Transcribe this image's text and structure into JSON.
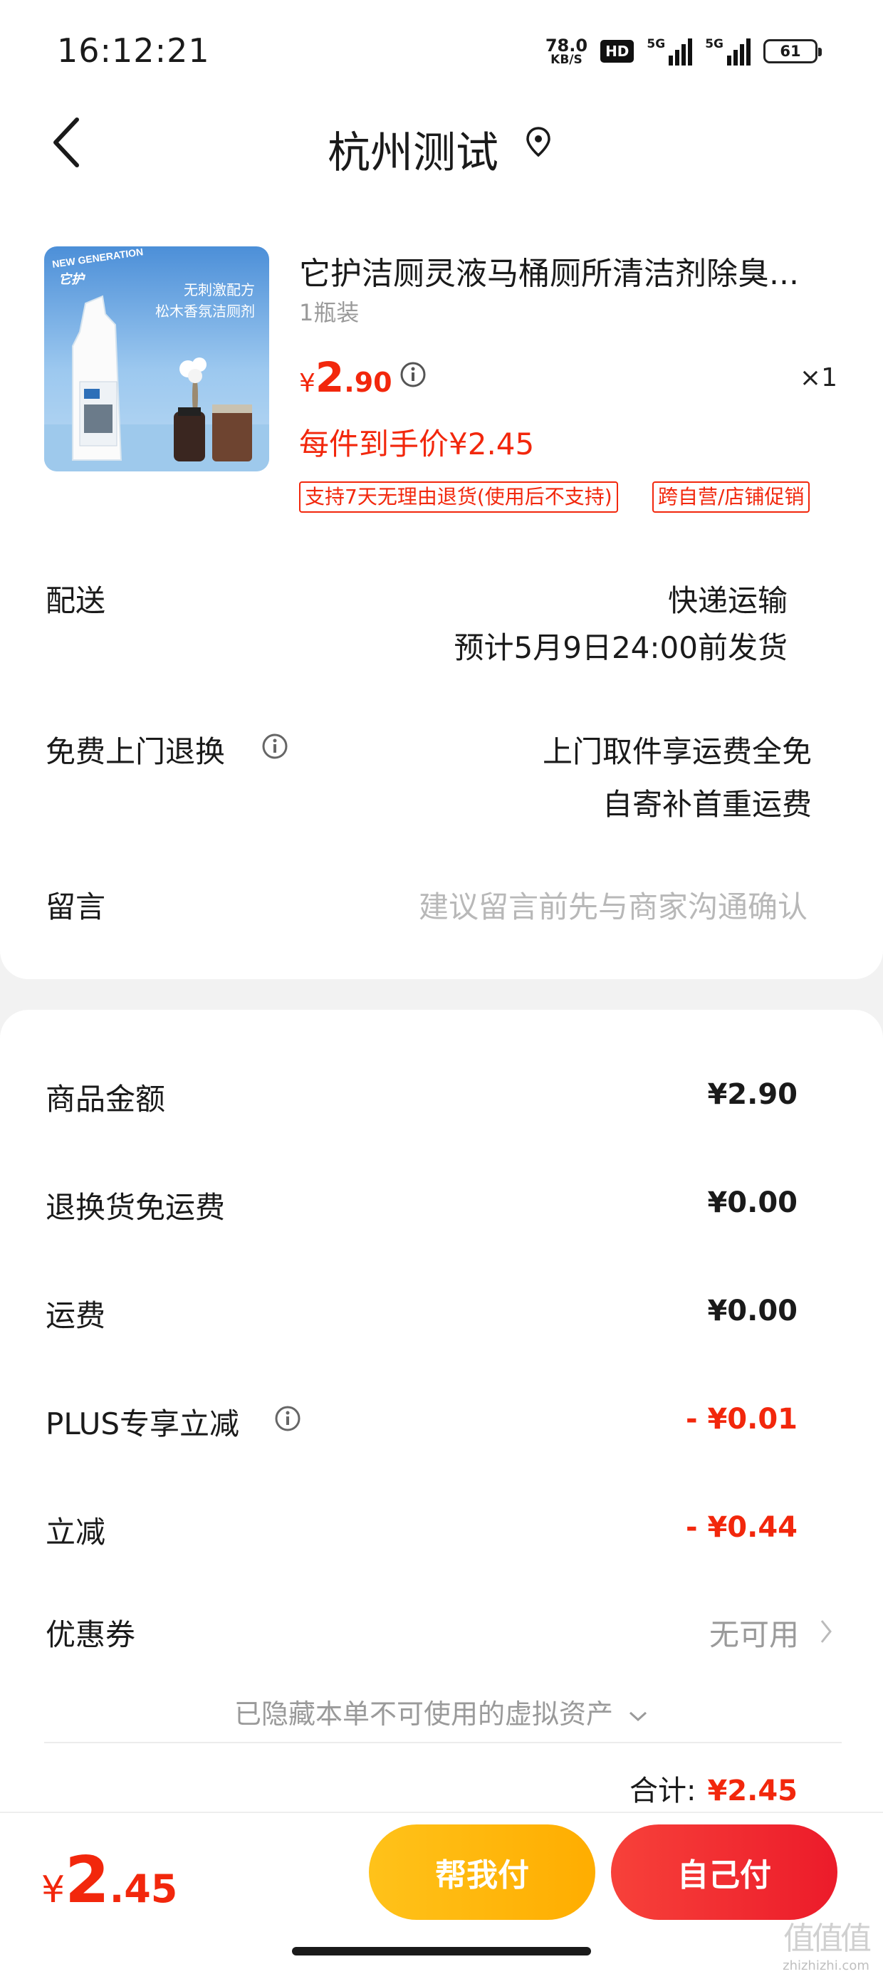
{
  "status_bar": {
    "time": "16:12:21",
    "net_speed_value": "78.0",
    "net_speed_unit": "KB/S",
    "hd": "HD",
    "sig1": "5G",
    "sig2": "5G",
    "battery": "61"
  },
  "header": {
    "title": "杭州测试"
  },
  "product": {
    "title": "它护洁厕灵液马桶厕所清洁剂除臭...",
    "spec": "1瓶装",
    "price_currency": "¥",
    "price_int": "2",
    "price_dec": ".90",
    "quantity": "×1",
    "unit_price": "每件到手价¥2.45",
    "tags": [
      "支持7天无理由退货(使用后不支持)",
      "跨自营/店铺促销"
    ],
    "image_brand": "NEW GENERATION",
    "image_logo": "它护",
    "image_text1": "无刺激配方",
    "image_text2": "松木香氛洁厕剂"
  },
  "delivery": {
    "label": "配送",
    "method": "快递运输",
    "eta": "预计5月9日24:00前发货"
  },
  "return_service": {
    "label": "免费上门退换",
    "line1": "上门取件享运费全免",
    "line2": "自寄补首重运费"
  },
  "message": {
    "label": "留言",
    "placeholder": "建议留言前先与商家沟通确认"
  },
  "summary": {
    "rows": [
      {
        "label": "商品金额",
        "value": "¥2.90"
      },
      {
        "label": "退换货免运费",
        "value": "¥0.00"
      },
      {
        "label": "运费",
        "value": "¥0.00"
      },
      {
        "label": "PLUS专享立减",
        "value": "- ¥0.01"
      },
      {
        "label": "立减",
        "value": "- ¥0.44"
      }
    ],
    "coupon_label": "优惠券",
    "coupon_value": "无可用",
    "hidden_note": "已隐藏本单不可使用的虚拟资产",
    "total_label": "合计:",
    "total_value": "¥2.45"
  },
  "bottom": {
    "currency": "¥",
    "price_int": "2",
    "price_dec": ".45",
    "help_pay": "帮我付",
    "self_pay": "自己付"
  },
  "watermark": {
    "logo": "值值值",
    "site": "zhizhizhi.com"
  },
  "colors": {
    "accent_red": "#f2270c",
    "help_button": "#ffb60d",
    "self_button": "#f0282e"
  }
}
